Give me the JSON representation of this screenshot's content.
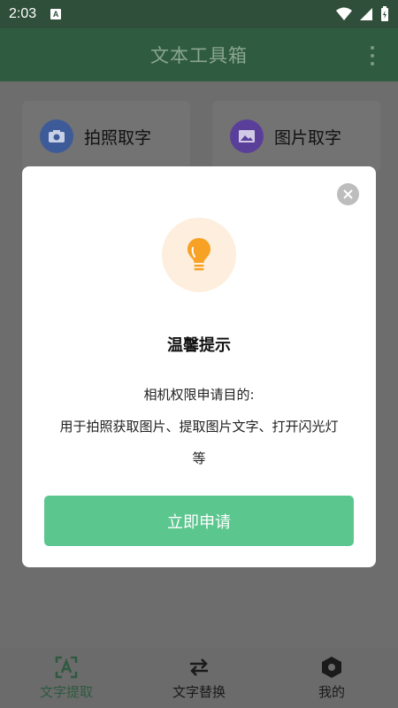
{
  "status_bar": {
    "time": "2:03",
    "a_badge": "A"
  },
  "app_bar": {
    "title": "文本工具箱"
  },
  "features": [
    {
      "label": "拍照取字",
      "icon": "camera-icon",
      "color": "#3d5a99"
    },
    {
      "label": "图片取字",
      "icon": "image-icon",
      "color": "#5a3f9a"
    }
  ],
  "dialog": {
    "title": "温馨提示",
    "body_line1": "相机权限申请目的:",
    "body_line2": "用于拍照获取图片、提取图片文字、打开闪光灯等",
    "confirm_label": "立即申请",
    "accent_color": "#5cc68f",
    "bulb_color": "#f7a224"
  },
  "bottom_nav": {
    "items": [
      {
        "label": "文字提取",
        "icon": "text-extract-icon",
        "active": true
      },
      {
        "label": "文字替换",
        "icon": "swap-icon",
        "active": false
      },
      {
        "label": "我的",
        "icon": "hexagon-icon",
        "active": false
      }
    ]
  }
}
